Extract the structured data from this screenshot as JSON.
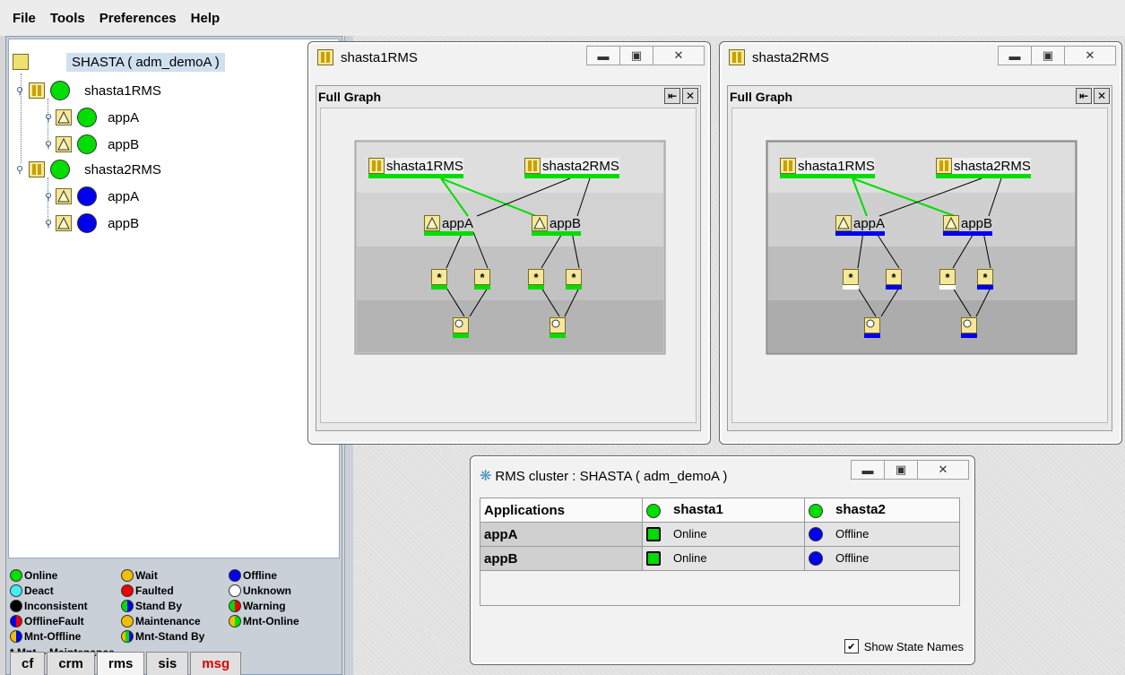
{
  "menu": [
    "File",
    "Tools",
    "Preferences",
    "Help"
  ],
  "tree": {
    "root_label": "SHASTA ( adm_demoA )",
    "nodes": [
      {
        "label": "shasta1RMS",
        "state_color": "#00dd00",
        "apps": [
          {
            "label": "appA",
            "state_color": "#00dd00"
          },
          {
            "label": "appB",
            "state_color": "#00dd00"
          }
        ]
      },
      {
        "label": "shasta2RMS",
        "state_color": "#00dd00",
        "apps": [
          {
            "label": "appA",
            "state_color": "#0000ee"
          },
          {
            "label": "appB",
            "state_color": "#0000ee"
          }
        ]
      }
    ]
  },
  "legend": {
    "items": [
      "Online",
      "Wait",
      "Offline",
      "Deact",
      "Faulted",
      "Unknown",
      "Inconsistent",
      "Stand By",
      "Warning",
      "OfflineFault",
      "Maintenance",
      "Mnt-Online",
      "Mnt-Offline",
      "Mnt-Stand By"
    ],
    "note": "* Mnt -- Maintenance"
  },
  "tabs": [
    "cf",
    "crm",
    "rms",
    "sis",
    "msg"
  ],
  "windows": {
    "w1": {
      "title": "shasta1RMS",
      "frame_title": "Full Graph",
      "node1": "shasta1RMS",
      "node2": "shasta2RMS",
      "appA": "appA",
      "appB": "appB",
      "appA_color": "#00dd00",
      "appB_color": "#00dd00",
      "res_colors": [
        "#00dd00",
        "#00dd00",
        "#00dd00",
        "#00dd00"
      ],
      "bottom_colors": [
        "#00dd00",
        "#00dd00"
      ]
    },
    "w2": {
      "title": "shasta2RMS",
      "frame_title": "Full Graph",
      "node1": "shasta1RMS",
      "node2": "shasta2RMS",
      "appA": "appA",
      "appB": "appB",
      "appA_color": "#0000ee",
      "appB_color": "#0000ee",
      "res_colors": [
        "#ffffff",
        "#0000ee",
        "#ffffff",
        "#0000ee"
      ],
      "bottom_colors": [
        "#0000ee",
        "#0000ee"
      ]
    },
    "cluster": {
      "title": "RMS cluster : SHASTA ( adm_demoA )",
      "col_apps": "Applications",
      "col_s1": "shasta1",
      "col_s2": "shasta2",
      "rows": [
        {
          "app": "appA",
          "s1": "Online",
          "s2": "Offline"
        },
        {
          "app": "appB",
          "s1": "Online",
          "s2": "Offline"
        }
      ],
      "show_state_names": "Show State Names"
    }
  }
}
